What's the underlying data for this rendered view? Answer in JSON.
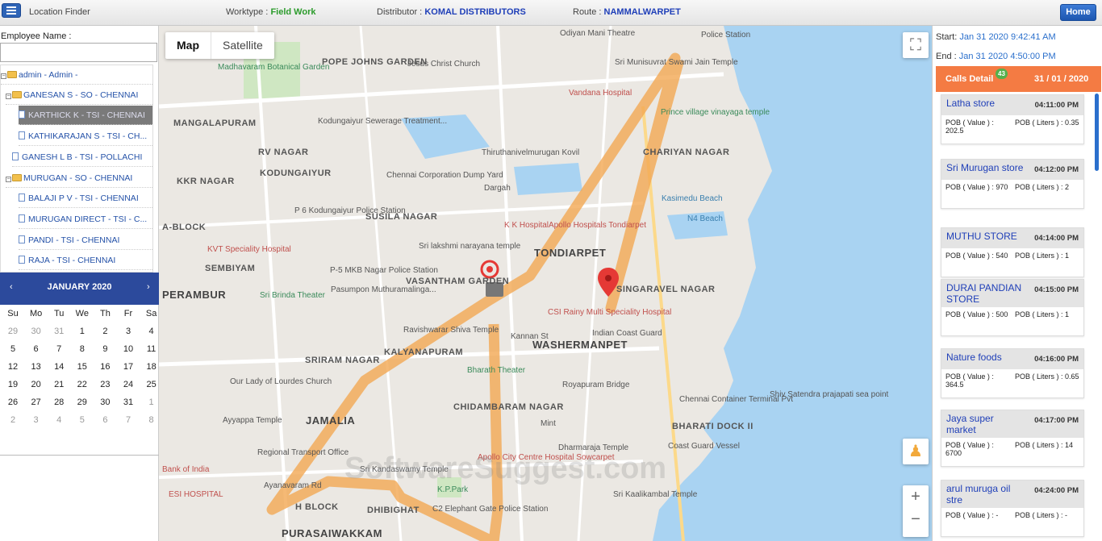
{
  "topbar": {
    "app_title": "Location Finder",
    "worktype_label": "Worktype :",
    "worktype_value": "Field Work",
    "distributor_label": "Distributor :",
    "distributor_value": "KOMAL DISTRIBUTORS",
    "route_label": "Route :",
    "route_value": "NAMMALWARPET",
    "home_label": "Home"
  },
  "sidebar": {
    "employee_label": "Employee Name :",
    "employee_value": "",
    "tree": [
      {
        "label": "admin - Admin -",
        "type": "folder"
      },
      {
        "label": "GANESAN S - SO - CHENNAI",
        "type": "folder"
      },
      {
        "label": "KARTHICK K - TSI - CHENNAI",
        "type": "doc",
        "selected": true
      },
      {
        "label": "KATHIKARAJAN S - TSI - CH...",
        "type": "doc"
      },
      {
        "label": "GANESH L B - TSI - POLLACHI",
        "type": "doc"
      },
      {
        "label": "MURUGAN - SO - CHENNAI",
        "type": "folder"
      },
      {
        "label": "BALAJI P V - TSI - CHENNAI",
        "type": "doc"
      },
      {
        "label": "MURUGAN DIRECT - TSI - C...",
        "type": "doc"
      },
      {
        "label": "PANDI - TSI - CHENNAI",
        "type": "doc"
      },
      {
        "label": "RAJA - TSI - CHENNAI",
        "type": "doc"
      }
    ]
  },
  "calendar": {
    "title": "JANUARY 2020",
    "prev": "‹",
    "next": "›",
    "weekdays": [
      "Su",
      "Mo",
      "Tu",
      "We",
      "Th",
      "Fr",
      "Sa"
    ],
    "weeks": [
      [
        "29",
        "30",
        "31",
        "1",
        "2",
        "3",
        "4"
      ],
      [
        "5",
        "6",
        "7",
        "8",
        "9",
        "10",
        "11"
      ],
      [
        "12",
        "13",
        "14",
        "15",
        "16",
        "17",
        "18"
      ],
      [
        "19",
        "20",
        "21",
        "22",
        "23",
        "24",
        "25"
      ],
      [
        "26",
        "27",
        "28",
        "29",
        "30",
        "31",
        "1"
      ],
      [
        "2",
        "3",
        "4",
        "5",
        "6",
        "7",
        "8"
      ]
    ]
  },
  "map": {
    "type_map": "Map",
    "type_satellite": "Satellite",
    "fullscreen_icon": "⛶",
    "zoom_in": "+",
    "zoom_out": "−",
    "watermark": "SoftwareSuggest.com",
    "labels": [
      "Odiyan Mani Theatre",
      "Police Station",
      "POPE JOHNS GARDEN",
      "Jesus Christ Church",
      "Madhavaram Botanical Garden",
      "Sri Munisuvrat Swami Jain Temple",
      "Vandana Hospital",
      "Prince village vinayaga temple",
      "MANGALAPURAM",
      "Kodungaiyur Sewerage Treatment...",
      "RV NAGAR",
      "Thiruthanivelmurugan Kovil",
      "CHARIYAN NAGAR",
      "KKR NAGAR",
      "KODUNGAIYUR",
      "Chennai Corporation Dump Yard",
      "Dargah",
      "Kasimedu Beach",
      "N4 Beach",
      "P 6 Kodungaiyur Police Station",
      "SUSILA NAGAR",
      "K K Hospital",
      "Apollo Hospitals Tondiarpet",
      "A-BLOCK",
      "KVT Speciality Hospital",
      "Sri lakshmi narayana temple",
      "TONDIARPET",
      "SEMBIYAM",
      "P-5 MKB Nagar Police Station",
      "VASANTHAM GARDEN",
      "SINGARAVEL NAGAR",
      "PERAMBUR",
      "Sri Brinda Theater",
      "Pasumpon Muthuramalinga...",
      "CSI Rainy Multi Speciality Hospital",
      "Indian Coast Guard",
      "Ravishwarar Shiva Temple",
      "KALYANAPURAM",
      "WASHERMANPET",
      "SRIRAM NAGAR",
      "Bharath Theater",
      "Royapuram Bridge",
      "Our Lady of Lourdes Church",
      "Chennai Container Terminal Pvt",
      "Shiv Satendra prajapati sea point",
      "JAMALIA",
      "CHIDAMBARAM NAGAR",
      "Mint",
      "BHARATI DOCK II",
      "Ayyappa Temple",
      "Regional Transport Office",
      "Dharmaraja Temple",
      "Coast Guard Vessel",
      "Apollo City Centre Hospital Sowcarpet",
      "Sri Kandaswamy Temple",
      "Bank of India",
      "K.P.Park",
      "ESI HOSPITAL",
      "H BLOCK",
      "DHIBIGHAT",
      "C2 Elephant Gate Police Station",
      "Sri Kaalikambal Temple",
      "PURASAIWAKKAM",
      "Ayanavaram Rd",
      "Kannan St"
    ]
  },
  "right_panel": {
    "start_label": "Start:",
    "start_value": "Jan 31 2020 9:42:41 AM",
    "end_label": "End :",
    "end_value": "Jan 31 2020 4:50:00 PM",
    "calls_title": "Calls Detail",
    "calls_count": "43",
    "calls_date": "31 / 01 / 2020",
    "calls": [
      {
        "name": "Latha store",
        "time": "04:11:00 PM",
        "pob_value": "POB ( Value ) : 202.5",
        "pob_liters": "POB ( Liters ) : 0.35"
      },
      {
        "name": "Sri Murugan store",
        "time": "04:12:00 PM",
        "pob_value": "POB ( Value ) : 970",
        "pob_liters": "POB ( Liters ) : 2"
      },
      {
        "name": "MUTHU STORE",
        "time": "04:14:00 PM",
        "pob_value": "POB ( Value ) : 540",
        "pob_liters": "POB ( Liters ) : 1"
      },
      {
        "name": "DURAI PANDIAN STORE",
        "time": "04:15:00 PM",
        "pob_value": "POB ( Value ) : 500",
        "pob_liters": "POB ( Liters ) : 1"
      },
      {
        "name": "Nature foods",
        "time": "04:16:00 PM",
        "pob_value": "POB ( Value ) : 364.5",
        "pob_liters": "POB ( Liters ) : 0.65"
      },
      {
        "name": "Jaya super market",
        "time": "04:17:00 PM",
        "pob_value": "POB ( Value ) : 6700",
        "pob_liters": "POB ( Liters ) : 14"
      },
      {
        "name": "arul muruga oil stre",
        "time": "04:24:00 PM",
        "pob_value": "POB ( Value ) : -",
        "pob_liters": "POB ( Liters ) : -"
      }
    ]
  }
}
